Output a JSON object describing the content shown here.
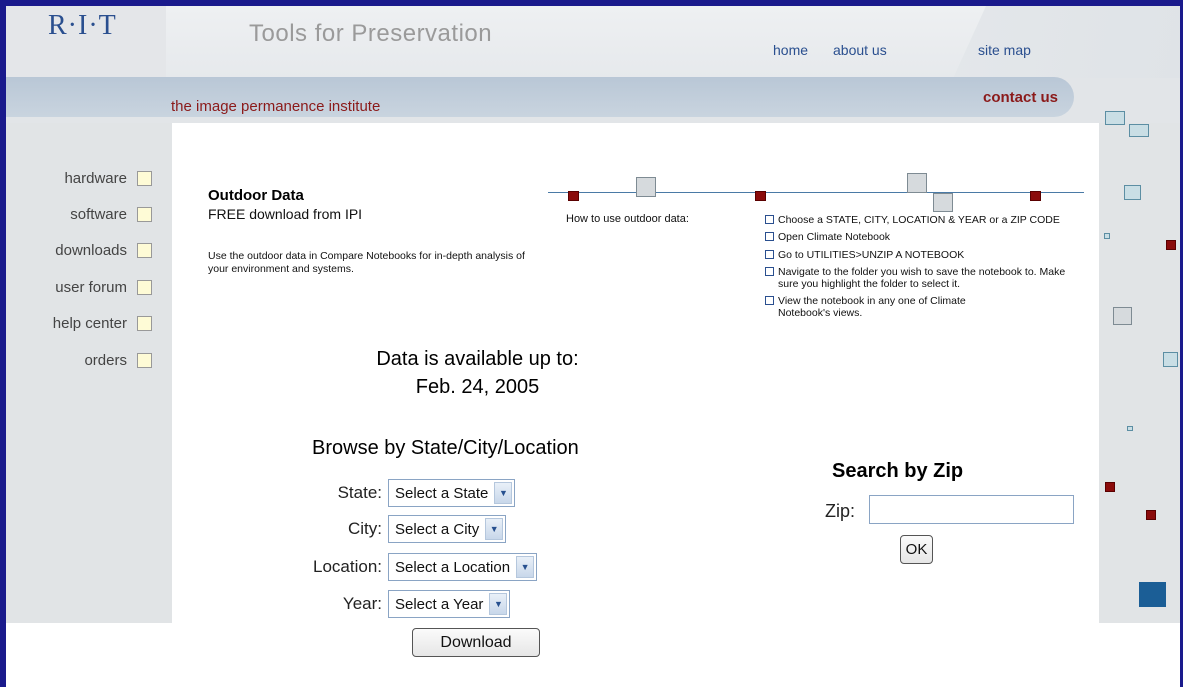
{
  "header": {
    "logo": "R·I·T",
    "site_title": "Tools for  Preservation",
    "nav": {
      "home": "home",
      "about": "about us",
      "sitemap": "site map"
    },
    "institute": "the image permanence institute",
    "contact": "contact us"
  },
  "sidebar": {
    "items": [
      {
        "label": "hardware"
      },
      {
        "label": "software"
      },
      {
        "label": "downloads"
      },
      {
        "label": "user forum"
      },
      {
        "label": "help center"
      },
      {
        "label": "orders"
      }
    ]
  },
  "outdoor": {
    "title": "Outdoor Data",
    "subtitle": "FREE download from IPI",
    "description": "Use the outdoor data in Compare Notebooks for in-depth analysis of your environment and systems."
  },
  "howto": {
    "label": "How to use outdoor data:",
    "steps": [
      "Choose a STATE, CITY, LOCATION & YEAR or a ZIP CODE",
      "Open Climate Notebook",
      "Go to UTILITIES>UNZIP A NOTEBOOK",
      "Navigate to the folder you wish to save the notebook to. Make sure you highlight the folder to select it.",
      "View the notebook in any one of Climate Notebook's views."
    ]
  },
  "availability": {
    "line1": "Data is available up to:",
    "line2": "Feb. 24, 2005"
  },
  "browse": {
    "title": "Browse by State/City/Location",
    "state_label": "State:",
    "state_value": "Select a State",
    "city_label": "City:",
    "city_value": "Select a City",
    "location_label": "Location:",
    "location_value": "Select a Location",
    "year_label": "Year:",
    "year_value": "Select a Year",
    "download_label": "Download"
  },
  "zip": {
    "title": "Search by Zip",
    "label": "Zip:",
    "value": "",
    "ok_label": "OK"
  },
  "colors": {
    "frame": "#1a1a8c",
    "accent_red": "#8b1a1a",
    "link_blue": "#2a4f8f",
    "sidebar_bg": "#e1e4e6"
  }
}
